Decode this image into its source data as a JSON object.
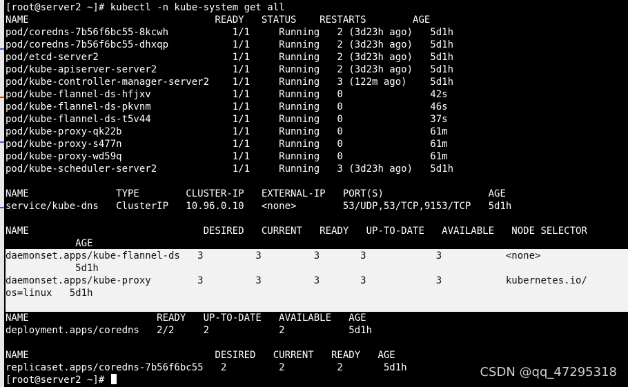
{
  "command_line": "[root@server2 ~]# kubectl -n kube-system get all",
  "pods_header": "NAME                                READY   STATUS    RESTARTS        AGE",
  "pods": [
    "pod/coredns-7b56f6bc55-8kcwh           1/1     Running   2 (3d23h ago)   5d1h",
    "pod/coredns-7b56f6bc55-dhxqp           1/1     Running   2 (3d23h ago)   5d1h",
    "pod/etcd-server2                       1/1     Running   2 (3d23h ago)   5d1h",
    "pod/kube-apiserver-server2             1/1     Running   2 (3d23h ago)   5d1h",
    "pod/kube-controller-manager-server2    1/1     Running   3 (122m ago)    5d1h",
    "pod/kube-flannel-ds-hfjxv              1/1     Running   0               42s",
    "pod/kube-flannel-ds-pkvnm              1/1     Running   0               46s",
    "pod/kube-flannel-ds-t5v44              1/1     Running   0               37s",
    "pod/kube-proxy-qk22b                   1/1     Running   0               61m",
    "pod/kube-proxy-s477n                   1/1     Running   0               61m",
    "pod/kube-proxy-wd59q                   1/1     Running   0               61m",
    "pod/kube-scheduler-server2             1/1     Running   3 (3d23h ago)   5d1h"
  ],
  "services_header": "NAME               TYPE        CLUSTER-IP   EXTERNAL-IP   PORT(S)                  AGE",
  "services": [
    "service/kube-dns   ClusterIP   10.96.0.10   <none>        53/UDP,53/TCP,9153/TCP   5d1h"
  ],
  "daemonsets_header": "NAME                              DESIRED   CURRENT   READY   UP-TO-DATE   AVAILABLE   NODE SELECTOR",
  "daemonsets_header_wrap": "            AGE",
  "daemonsets": [
    "daemonset.apps/kube-flannel-ds   3         3         3       3            3           <none>",
    "            5d1h",
    "daemonset.apps/kube-proxy        3         3         3       3            3           kubernetes.io/",
    "os=linux   5d1h"
  ],
  "deployments_header": "NAME                      READY   UP-TO-DATE   AVAILABLE   AGE",
  "deployments": [
    "deployment.apps/coredns   2/2     2            2           5d1h"
  ],
  "replicasets_header": "NAME                                DESIRED   CURRENT   READY   AGE",
  "replicasets": [
    "replicaset.apps/coredns-7b56f6bc55   2         2         2       5d1h"
  ],
  "prompt": "[root@server2 ~]# ",
  "watermark": "CSDN @qq_47295318",
  "colors": {
    "background": "#000000",
    "text": "#ffffff",
    "highlight_band": "#f2f2f2",
    "highlight_text": "#111111"
  }
}
